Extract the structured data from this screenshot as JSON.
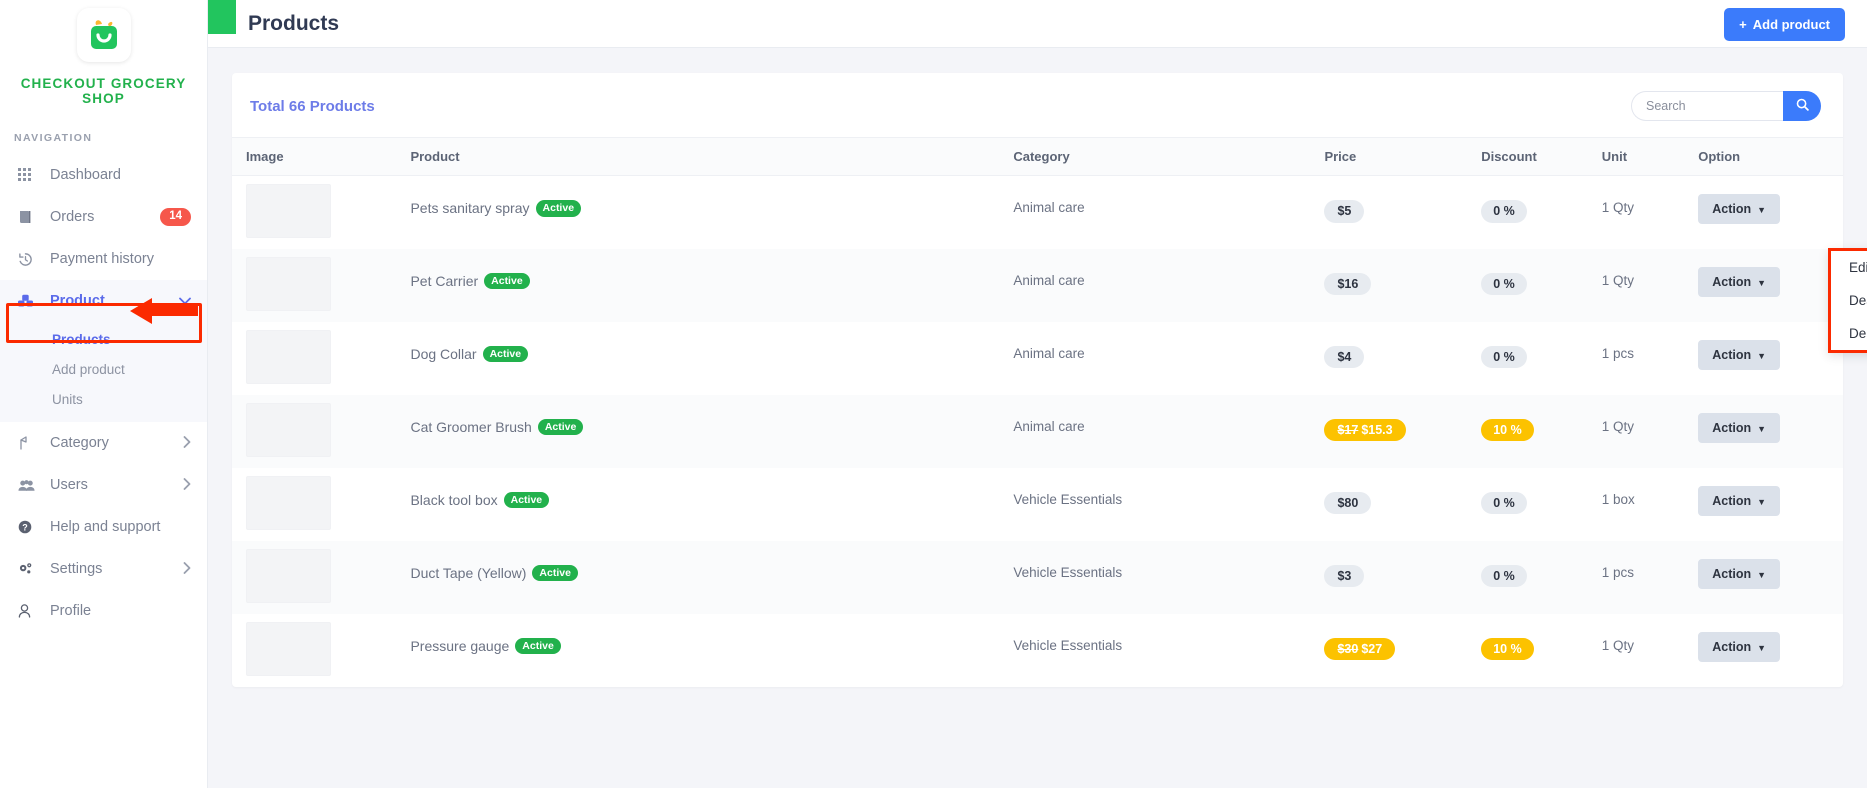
{
  "sidebar": {
    "brand": "CHECKOUT GROCERY SHOP",
    "nav_label": "NAVIGATION",
    "items": [
      {
        "label": "Dashboard",
        "icon": "grid-icon",
        "badge": null,
        "chevron": null
      },
      {
        "label": "Orders",
        "icon": "book-icon",
        "badge": "14",
        "chevron": null
      },
      {
        "label": "Payment history",
        "icon": "history-icon",
        "badge": null,
        "chevron": null
      },
      {
        "label": "Product",
        "icon": "boxes-icon",
        "badge": null,
        "chevron": "down"
      },
      {
        "label": "Category",
        "icon": "tag-icon",
        "badge": null,
        "chevron": "right"
      },
      {
        "label": "Users",
        "icon": "users-icon",
        "badge": null,
        "chevron": "right"
      },
      {
        "label": "Help and support",
        "icon": "question-circle-icon",
        "badge": null,
        "chevron": null
      },
      {
        "label": "Settings",
        "icon": "gears-icon",
        "badge": null,
        "chevron": "right"
      },
      {
        "label": "Profile",
        "icon": "user-icon",
        "badge": null,
        "chevron": null
      }
    ],
    "product_submenu": [
      {
        "label": "Products",
        "active": true
      },
      {
        "label": "Add product",
        "active": false
      },
      {
        "label": "Units",
        "active": false
      }
    ]
  },
  "header": {
    "title": "Products",
    "add_button": "Add product",
    "add_button_icon": "plus-icon"
  },
  "card": {
    "total_label": "Total 66 Products",
    "search_placeholder": "Search",
    "search_value": "",
    "search_icon": "search-icon"
  },
  "table": {
    "columns": [
      "Image",
      "Product",
      "Category",
      "Price",
      "Discount",
      "Unit",
      "Option"
    ],
    "action_label": "Action",
    "rows": [
      {
        "image_alt": "spray-bottle-thumbnail",
        "product": "Pets sanitary spray",
        "status": "Active",
        "category": "Animal care",
        "price": "$5",
        "old_price": "",
        "on_sale": false,
        "discount": "0 %",
        "unit": "1 Qty"
      },
      {
        "image_alt": "pet-carrier-thumbnail",
        "product": "Pet Carrier",
        "status": "Active",
        "category": "Animal care",
        "price": "$16",
        "old_price": "",
        "on_sale": false,
        "discount": "0 %",
        "unit": "1 Qty"
      },
      {
        "image_alt": "dog-collar-thumbnail",
        "product": "Dog Collar",
        "status": "Active",
        "category": "Animal care",
        "price": "$4",
        "old_price": "",
        "on_sale": false,
        "discount": "0 %",
        "unit": "1 pcs"
      },
      {
        "image_alt": "cat-groomer-brush-thumbnail",
        "product": "Cat Groomer Brush",
        "status": "Active",
        "category": "Animal care",
        "price": "$15.3",
        "old_price": "$17",
        "on_sale": true,
        "discount": "10 %",
        "unit": "1 Qty"
      },
      {
        "image_alt": "black-tool-box-thumbnail",
        "product": "Black tool box",
        "status": "Active",
        "category": "Vehicle Essentials",
        "price": "$80",
        "old_price": "",
        "on_sale": false,
        "discount": "0 %",
        "unit": "1 box"
      },
      {
        "image_alt": "duct-tape-thumbnail",
        "product": "Duct Tape (Yellow)",
        "status": "Active",
        "category": "Vehicle Essentials",
        "price": "$3",
        "old_price": "",
        "on_sale": false,
        "discount": "0 %",
        "unit": "1 pcs"
      },
      {
        "image_alt": "pressure-gauge-thumbnail",
        "product": "Pressure gauge",
        "status": "Active",
        "category": "Vehicle Essentials",
        "price": "$27",
        "old_price": "$30",
        "on_sale": true,
        "discount": "10 %",
        "unit": "1 Qty"
      }
    ]
  },
  "dropdown": {
    "items": [
      "Edit",
      "Deactivate",
      "Delete"
    ]
  },
  "colors": {
    "brand_green": "#22b14c",
    "accent_blue": "#3b7bfb",
    "nav_active": "#5b6bea",
    "sale_yellow": "#fcc200",
    "badge_red": "#f6574b",
    "annotation_red": "#fb2a00"
  }
}
